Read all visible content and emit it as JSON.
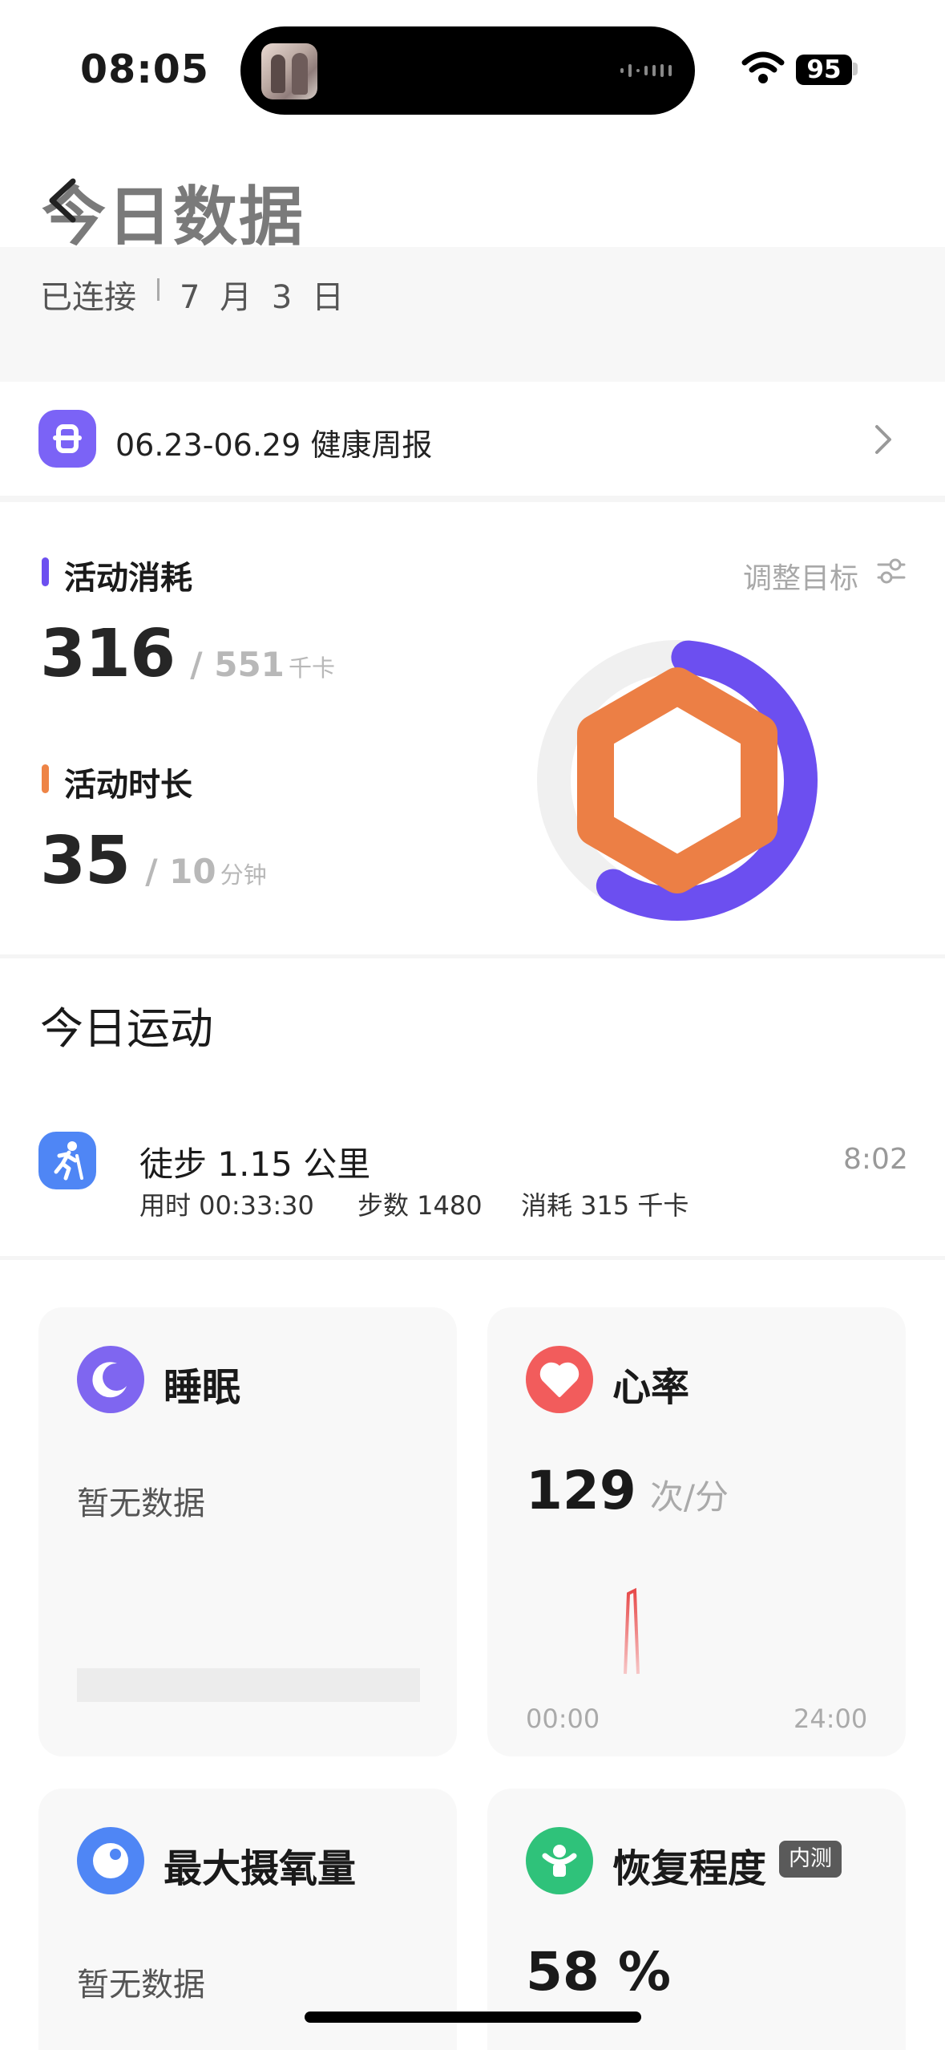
{
  "status_bar": {
    "time": "08:05",
    "battery": "95"
  },
  "header": {
    "title": "今日数据",
    "connection": "已连接",
    "date": "7 月 3 日"
  },
  "weekly_report": {
    "label": "06.23-06.29 健康周报"
  },
  "activity": {
    "adjust_label": "调整目标",
    "calories": {
      "label": "活动消耗",
      "value": "316",
      "goal": "/ 551",
      "unit": "千卡",
      "progress": 0.573
    },
    "duration": {
      "label": "活动时长",
      "value": "35",
      "goal": "/ 10",
      "unit": "分钟",
      "progress": 1.0
    },
    "colors": {
      "calories": "#6c4ff0",
      "duration": "#ec7f45",
      "track": "#f0f0f0"
    }
  },
  "exercise": {
    "section_title": "今日运动",
    "items": [
      {
        "title": "徒步 1.15 公里",
        "duration": "用时 00:33:30",
        "steps": "步数 1480",
        "calories": "消耗 315 千卡",
        "time": "8:02"
      }
    ]
  },
  "cards": {
    "sleep": {
      "title": "睡眠",
      "status": "暂无数据",
      "color": "#7f66f0"
    },
    "heart_rate": {
      "title": "心率",
      "value": "129",
      "unit": "次/分",
      "axis_start": "00:00",
      "axis_end": "24:00",
      "color": "#f25c5c"
    },
    "vo2max": {
      "title": "最大摄氧量",
      "status": "暂无数据",
      "color": "#4f86f5"
    },
    "recovery": {
      "title": "恢复程度",
      "badge": "内测",
      "value": "58 %",
      "color": "#2fc27a"
    }
  }
}
